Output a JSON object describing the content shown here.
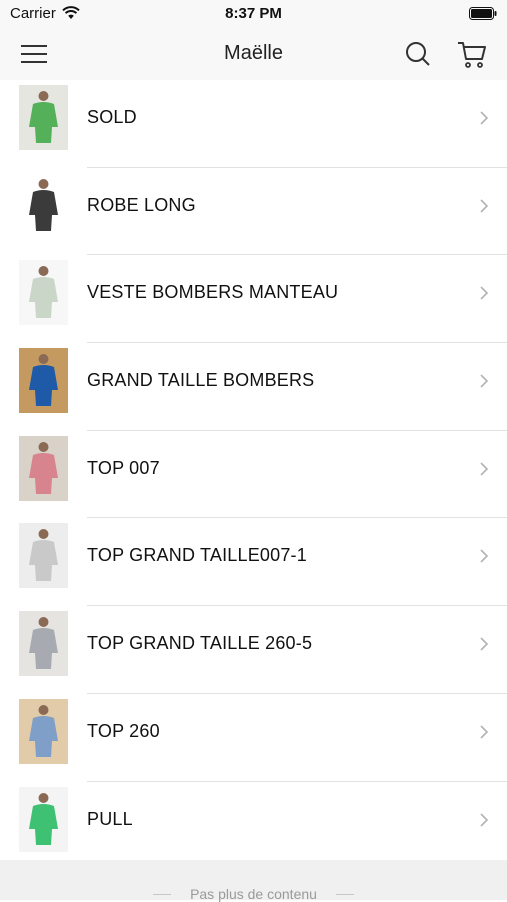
{
  "status": {
    "carrier": "Carrier",
    "time": "8:37 PM"
  },
  "nav": {
    "title": "Maëlle",
    "menu_icon": "hamburger-menu-icon",
    "search_icon": "search-icon",
    "cart_icon": "cart-icon"
  },
  "categories": [
    {
      "label": "SOLD",
      "thumb_colors": [
        "#e6e6e0",
        "#55b05a"
      ]
    },
    {
      "label": "ROBE LONG",
      "thumb_colors": [
        "#ffffff",
        "#3b3b3b"
      ]
    },
    {
      "label": "VESTE BOMBERS MANTEAU",
      "thumb_colors": [
        "#f7f7f7",
        "#c9d6c8"
      ]
    },
    {
      "label": "GRAND TAILLE BOMBERS",
      "thumb_colors": [
        "#c49a60",
        "#1e5aa8"
      ]
    },
    {
      "label": "TOP 007",
      "thumb_colors": [
        "#d9d2c8",
        "#d7848e"
      ]
    },
    {
      "label": "TOP GRAND TAILLE007-1",
      "thumb_colors": [
        "#ededed",
        "#c9c9c9"
      ]
    },
    {
      "label": "TOP GRAND TAILLE 260-5",
      "thumb_colors": [
        "#e6e4e0",
        "#a7abb1"
      ]
    },
    {
      "label": "TOP 260",
      "thumb_colors": [
        "#e2cba8",
        "#7f9fc8"
      ]
    },
    {
      "label": "PULL",
      "thumb_colors": [
        "#f4f4f4",
        "#3ec173"
      ]
    }
  ],
  "footer": {
    "text": "Pas plus de contenu"
  }
}
